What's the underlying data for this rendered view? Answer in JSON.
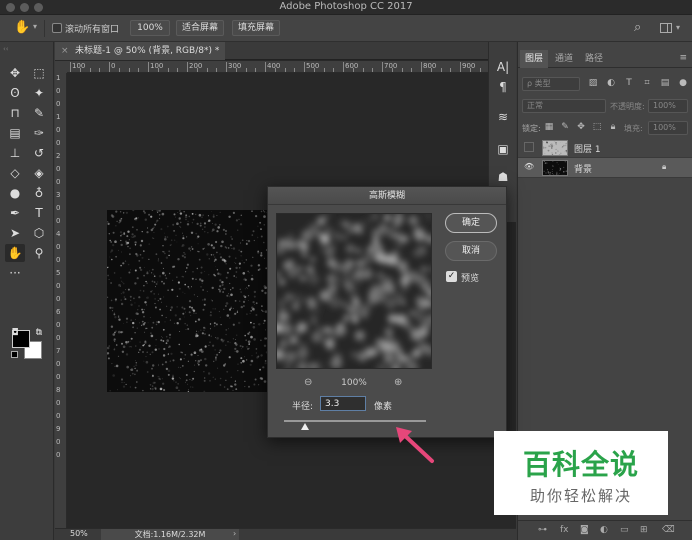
{
  "window": {
    "title": "Adobe Photoshop CC 2017",
    "traffic_colors": [
      "#fc605c",
      "#fdbc40",
      "#34c84a"
    ]
  },
  "options_bar": {
    "tool_icon": "hand-icon",
    "scroll_all_label": "滚动所有窗口",
    "zoom_100_label": "100%",
    "fit_screen_label": "适合屏幕",
    "fill_screen_label": "填充屏幕"
  },
  "document": {
    "tab_title": "未标题-1 @ 50% (背景, RGB/8*) *",
    "ruler_top_labels": [
      "100",
      "0",
      "100",
      "200",
      "300",
      "400",
      "500",
      "600",
      "700",
      "800",
      "900"
    ],
    "ruler_left_labels": [
      "1",
      "0",
      "0",
      "1",
      "0",
      "0",
      "2",
      "0",
      "0",
      "3",
      "0",
      "0",
      "4",
      "0",
      "0",
      "5",
      "0",
      "0",
      "6",
      "0",
      "0",
      "7",
      "0",
      "0",
      "8",
      "0",
      "0",
      "9",
      "0",
      "0"
    ],
    "zoom": "50%",
    "doc_info": "文档:1.16M/2.32M"
  },
  "layers_panel": {
    "tabs": [
      "图层",
      "通道",
      "路径"
    ],
    "active_tab": 0,
    "filter_placeholder": "ρ 类型",
    "blend_mode": "正常",
    "opacity_label": "不透明度:",
    "opacity_value": "100%",
    "lock_label": "锁定:",
    "fill_label": "填充:",
    "fill_value": "100%",
    "layers": [
      {
        "name": "图层 1",
        "visible": false,
        "selected": false,
        "locked": false
      },
      {
        "name": "背景",
        "visible": true,
        "selected": true,
        "locked": true
      }
    ],
    "bottom_icons": [
      "link-icon",
      "fx-icon",
      "mask-icon",
      "adjustment-icon",
      "group-icon",
      "new-layer-icon",
      "trash-icon"
    ]
  },
  "dialog": {
    "title": "高斯模糊",
    "ok_label": "确定",
    "cancel_label": "取消",
    "preview_label": "预览",
    "preview_checked": true,
    "zoom_pct": "100%",
    "radius_label": "半径:",
    "radius_value": "3.3",
    "radius_unit": "像素",
    "slider_fraction": 0.15
  },
  "watermark": {
    "main": "百科全说",
    "sub": "助你轻松解决",
    "color": "#2aa34a"
  },
  "annotation_arrow_color": "#e6477a"
}
